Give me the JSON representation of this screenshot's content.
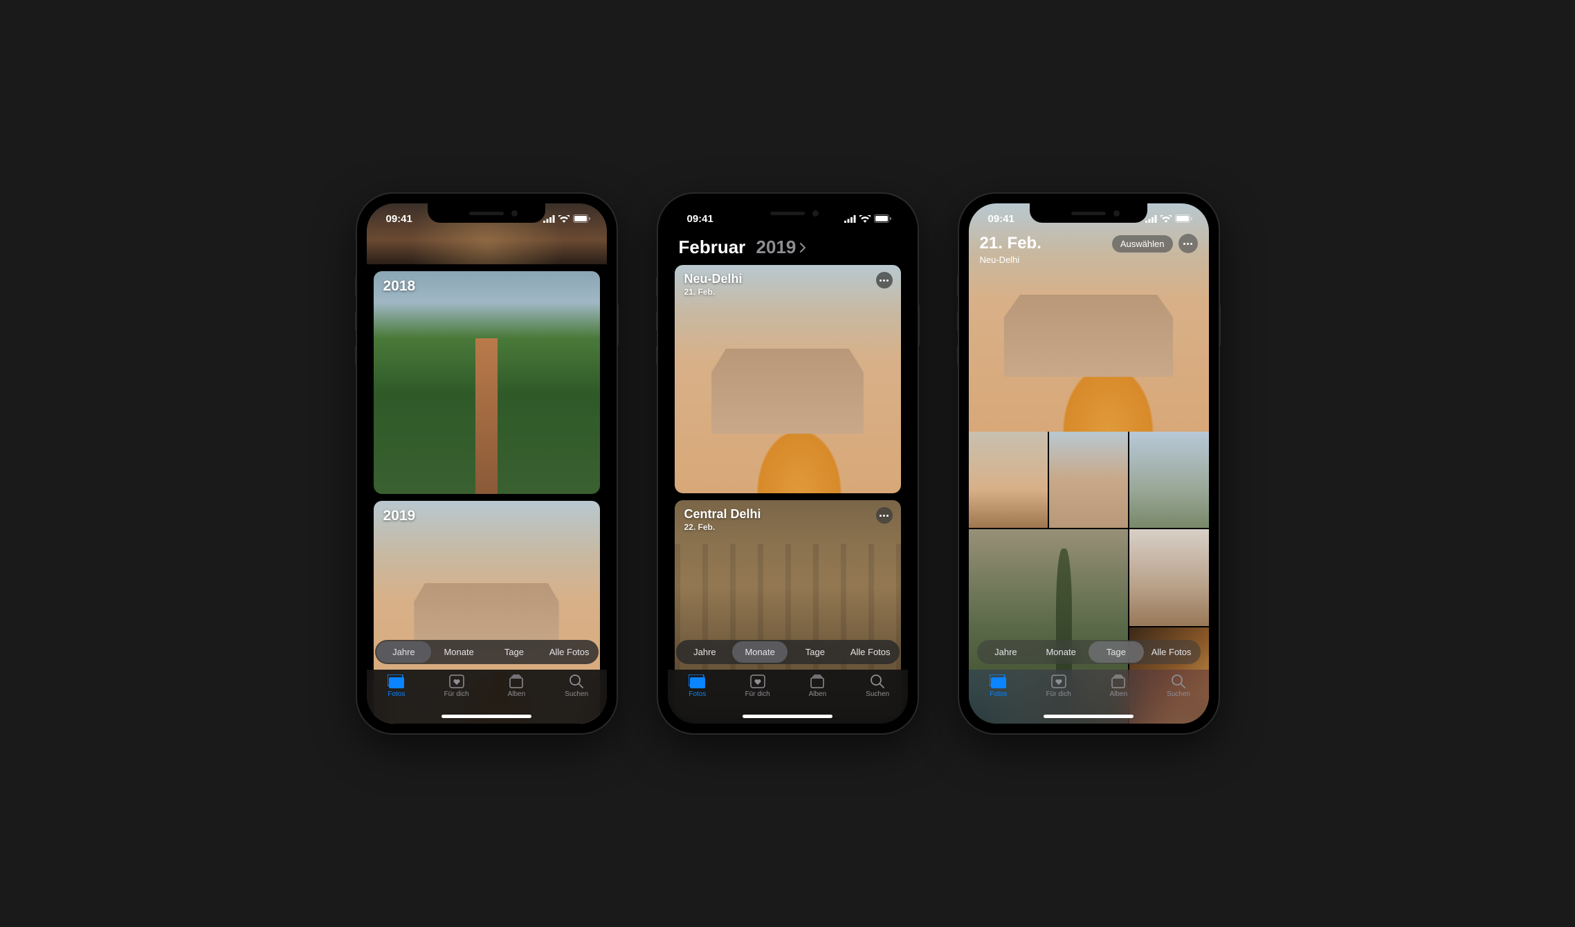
{
  "status": {
    "time": "09:41"
  },
  "segments": {
    "years": "Jahre",
    "months": "Monate",
    "days": "Tage",
    "all": "Alle Fotos"
  },
  "tabs": {
    "photos": "Fotos",
    "for_you": "Für dich",
    "albums": "Alben",
    "search": "Suchen"
  },
  "phone1": {
    "active_segment": "years",
    "years": [
      {
        "label": "2018"
      },
      {
        "label": "2019"
      }
    ]
  },
  "phone2": {
    "active_segment": "months",
    "title_month": "Februar",
    "title_year": "2019",
    "cards": [
      {
        "title": "Neu-Delhi",
        "subtitle": "21. Feb."
      },
      {
        "title": "Central Delhi",
        "subtitle": "22. Feb."
      }
    ]
  },
  "phone3": {
    "active_segment": "days",
    "date": "21. Feb.",
    "location": "Neu-Delhi",
    "select_label": "Auswählen"
  }
}
